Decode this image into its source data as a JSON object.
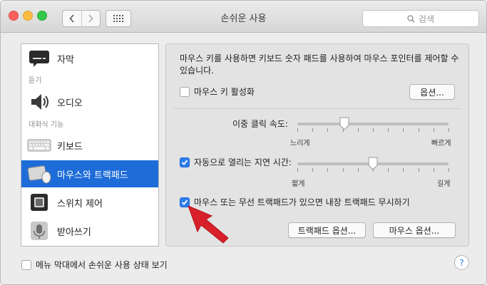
{
  "window": {
    "title": "손쉬운 사용"
  },
  "toolbar": {
    "search_placeholder": "검색"
  },
  "sidebar": {
    "groups": [
      {
        "header": ""
      },
      {
        "header": "듣기"
      },
      {
        "header": "대화식 기능"
      }
    ],
    "items": [
      {
        "label": "자막",
        "icon": "captions-icon"
      },
      {
        "label": "오디오",
        "icon": "speaker-icon"
      },
      {
        "label": "키보드",
        "icon": "keyboard-icon"
      },
      {
        "label": "마우스와 트랙패드",
        "icon": "mouse-trackpad-icon",
        "selected": true
      },
      {
        "label": "스위치 제어",
        "icon": "switch-control-icon"
      },
      {
        "label": "받아쓰기",
        "icon": "microphone-icon"
      }
    ]
  },
  "main": {
    "description": "마우스 키를 사용하면 키보드 숫자 패드를 사용하여 마우스 포인터를 제어할 수 있습니다.",
    "mouse_keys_checkbox": {
      "label": "마우스 키 활성화",
      "checked": false
    },
    "options_button": "옵션...",
    "double_click": {
      "label": "이중 클릭 속도:",
      "min_label": "느리게",
      "max_label": "빠르게",
      "value_fraction": 0.31
    },
    "spring_loading": {
      "label": "자동으로 열리는 지연 시간:",
      "checked": true,
      "min_label": "짧게",
      "max_label": "길게",
      "value_fraction": 0.5
    },
    "ignore_trackpad": {
      "label": "마우스 또는 무선 트랙패드가 있으면 내장 트랙패드 무시하기",
      "checked": true
    },
    "trackpad_options_button": "트랙패드 옵션...",
    "mouse_options_button": "마우스 옵션..."
  },
  "footer": {
    "menu_bar_checkbox": {
      "label": "메뉴 막대에서 손쉬운 사용 상태 보기",
      "checked": false
    },
    "help_label": "?"
  },
  "colors": {
    "accent": "#1d6cd8",
    "checkbox_blue": "#2d7cf0",
    "arrow_red": "#d8202a"
  }
}
